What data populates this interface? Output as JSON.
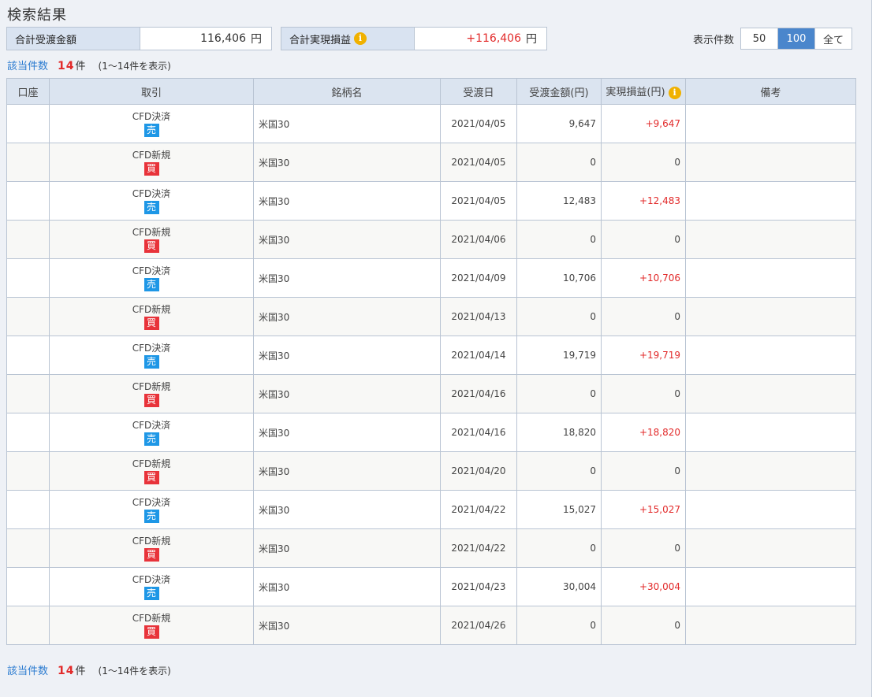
{
  "header": {
    "title": "検索結果",
    "total_amount_label": "合計受渡金額",
    "total_amount_value": "116,406",
    "total_pl_label": "合計実現損益",
    "total_pl_value": "+116,406",
    "yen": "円",
    "info_glyph": "i"
  },
  "display_count": {
    "label": "表示件数",
    "options": [
      "50",
      "100",
      "全て"
    ],
    "selected": "100"
  },
  "count_summary": {
    "label": "該当件数",
    "count": "14",
    "unit": "件",
    "range": "(1〜14件を表示)"
  },
  "table": {
    "headers": [
      "口座",
      "取引",
      "銘柄名",
      "受渡日",
      "受渡金額(円)",
      "実現損益(円)",
      "備考"
    ],
    "rows": [
      {
        "account": "",
        "trade": "CFD決済",
        "side": "売",
        "side_type": "sell",
        "symbol": "米国30",
        "date": "2021/04/05",
        "amount": "9,647",
        "pl": "+9,647",
        "note": ""
      },
      {
        "account": "",
        "trade": "CFD新規",
        "side": "買",
        "side_type": "buy",
        "symbol": "米国30",
        "date": "2021/04/05",
        "amount": "0",
        "pl": "0",
        "note": ""
      },
      {
        "account": "",
        "trade": "CFD決済",
        "side": "売",
        "side_type": "sell",
        "symbol": "米国30",
        "date": "2021/04/05",
        "amount": "12,483",
        "pl": "+12,483",
        "note": ""
      },
      {
        "account": "",
        "trade": "CFD新規",
        "side": "買",
        "side_type": "buy",
        "symbol": "米国30",
        "date": "2021/04/06",
        "amount": "0",
        "pl": "0",
        "note": ""
      },
      {
        "account": "",
        "trade": "CFD決済",
        "side": "売",
        "side_type": "sell",
        "symbol": "米国30",
        "date": "2021/04/09",
        "amount": "10,706",
        "pl": "+10,706",
        "note": ""
      },
      {
        "account": "",
        "trade": "CFD新規",
        "side": "買",
        "side_type": "buy",
        "symbol": "米国30",
        "date": "2021/04/13",
        "amount": "0",
        "pl": "0",
        "note": ""
      },
      {
        "account": "",
        "trade": "CFD決済",
        "side": "売",
        "side_type": "sell",
        "symbol": "米国30",
        "date": "2021/04/14",
        "amount": "19,719",
        "pl": "+19,719",
        "note": ""
      },
      {
        "account": "",
        "trade": "CFD新規",
        "side": "買",
        "side_type": "buy",
        "symbol": "米国30",
        "date": "2021/04/16",
        "amount": "0",
        "pl": "0",
        "note": ""
      },
      {
        "account": "",
        "trade": "CFD決済",
        "side": "売",
        "side_type": "sell",
        "symbol": "米国30",
        "date": "2021/04/16",
        "amount": "18,820",
        "pl": "+18,820",
        "note": ""
      },
      {
        "account": "",
        "trade": "CFD新規",
        "side": "買",
        "side_type": "buy",
        "symbol": "米国30",
        "date": "2021/04/20",
        "amount": "0",
        "pl": "0",
        "note": ""
      },
      {
        "account": "",
        "trade": "CFD決済",
        "side": "売",
        "side_type": "sell",
        "symbol": "米国30",
        "date": "2021/04/22",
        "amount": "15,027",
        "pl": "+15,027",
        "note": ""
      },
      {
        "account": "",
        "trade": "CFD新規",
        "side": "買",
        "side_type": "buy",
        "symbol": "米国30",
        "date": "2021/04/22",
        "amount": "0",
        "pl": "0",
        "note": ""
      },
      {
        "account": "",
        "trade": "CFD決済",
        "side": "売",
        "side_type": "sell",
        "symbol": "米国30",
        "date": "2021/04/23",
        "amount": "30,004",
        "pl": "+30,004",
        "note": ""
      },
      {
        "account": "",
        "trade": "CFD新規",
        "side": "買",
        "side_type": "buy",
        "symbol": "米国30",
        "date": "2021/04/26",
        "amount": "0",
        "pl": "0",
        "note": ""
      }
    ]
  },
  "colors": {
    "positive": "#e22a2a",
    "sell_badge": "#1e97e6",
    "buy_badge": "#e8333a",
    "link": "#2b7bd0",
    "selected_option": "#4a86cc"
  }
}
